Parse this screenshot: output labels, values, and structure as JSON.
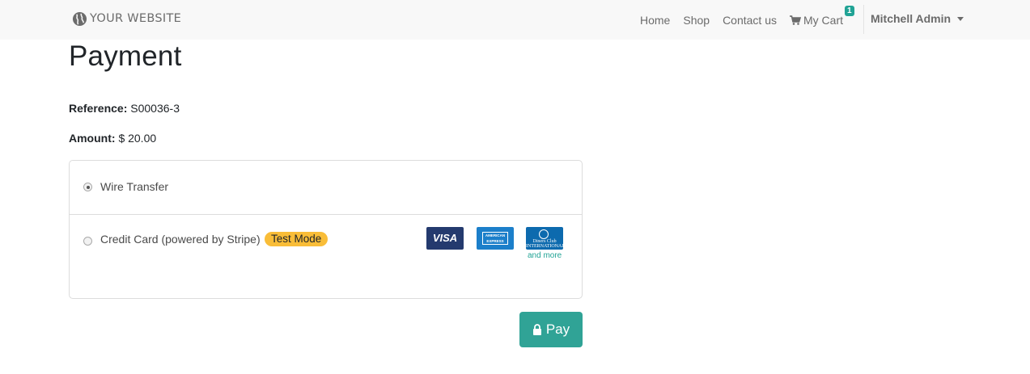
{
  "brand": {
    "text": "YOUR WEBSITE",
    "icon": "globe-icon"
  },
  "nav": {
    "items": [
      "Home",
      "Shop",
      "Contact us"
    ],
    "cart_label": "My Cart",
    "cart_count": "1",
    "user_name": "Mitchell Admin"
  },
  "page": {
    "title": "Payment",
    "reference_label": "Reference:",
    "reference_value": "S00036-3",
    "amount_label": "Amount:",
    "amount_value": "$ 20.00"
  },
  "payment_methods": [
    {
      "label": "Wire Transfer",
      "selected": true
    },
    {
      "label": "Credit Card (powered by Stripe)",
      "selected": false,
      "badge": "Test Mode"
    }
  ],
  "cards": {
    "visa": "VISA",
    "amex": "AMERICAN EXPRESS",
    "diners": "Diners Club INTERNATIONAL",
    "and_more": "and more"
  },
  "pay_button": "Pay",
  "colors": {
    "accent": "#30a396",
    "badge": "#f9bd38",
    "navbar": "#f8f8f8"
  }
}
